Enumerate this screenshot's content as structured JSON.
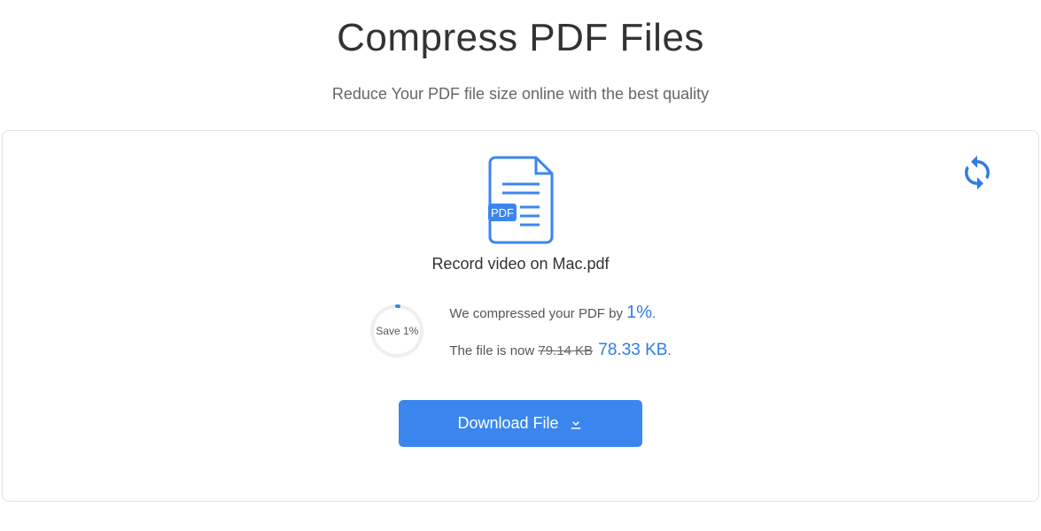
{
  "header": {
    "title": "Compress PDF Files",
    "subtitle": "Reduce Your PDF file size online with the best quality"
  },
  "file": {
    "name": "Record video on Mac.pdf"
  },
  "result": {
    "ring_label": "Save 1%",
    "line1_prefix": "We compressed your PDF by ",
    "percent": "1%",
    "line1_suffix": ".",
    "line2_prefix": "The file is now ",
    "old_size": "79.14 KB",
    "new_size": "78.33 KB",
    "line2_suffix": "."
  },
  "buttons": {
    "download": "Download File"
  }
}
